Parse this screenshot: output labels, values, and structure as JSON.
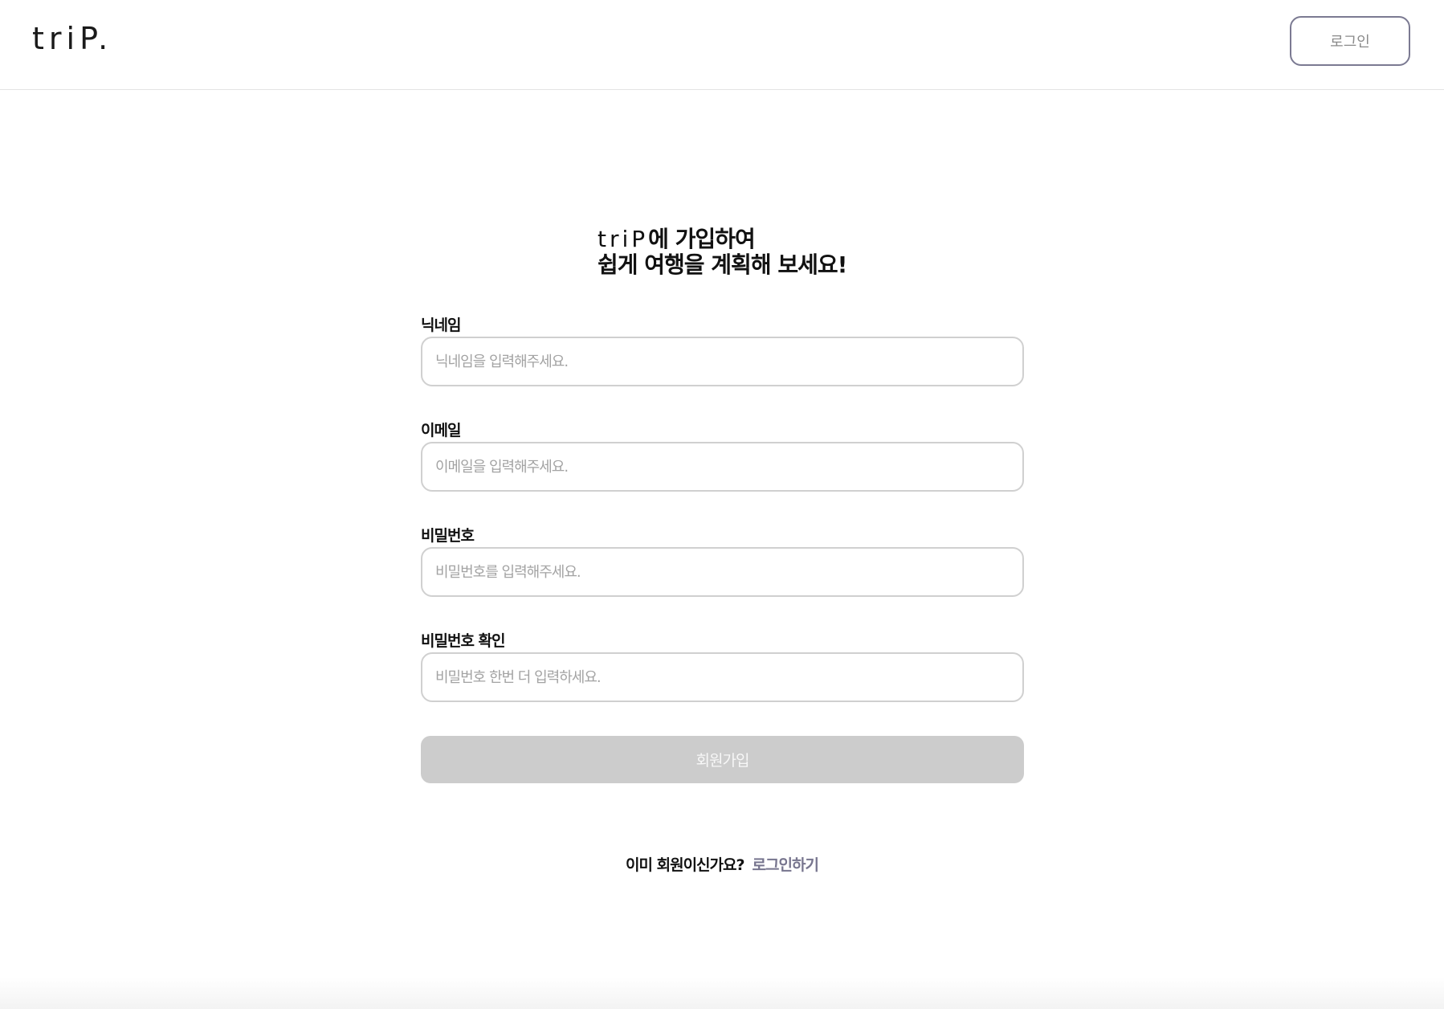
{
  "header": {
    "logo": "triP.",
    "login_label": "로그인"
  },
  "title": {
    "brand": "triP",
    "line1_rest": "에 가입하여",
    "line2": "쉽게 여행을 계획해 보세요!"
  },
  "form": {
    "fields": [
      {
        "label": "닉네임",
        "placeholder": "닉네임을 입력해주세요.",
        "type": "text"
      },
      {
        "label": "이메일",
        "placeholder": "이메일을 입력해주세요.",
        "type": "email"
      },
      {
        "label": "비밀번호",
        "placeholder": "비밀번호를 입력해주세요.",
        "type": "password"
      },
      {
        "label": "비밀번호 확인",
        "placeholder": "비밀번호 한번 더 입력하세요.",
        "type": "password"
      }
    ],
    "submit_label": "회원가입"
  },
  "footer": {
    "question": "이미 회원이신가요?",
    "login_link": "로그인하기"
  },
  "colors": {
    "accent": "#77758e",
    "button_disabled": "#cccccc",
    "border": "#d0d0d0"
  }
}
